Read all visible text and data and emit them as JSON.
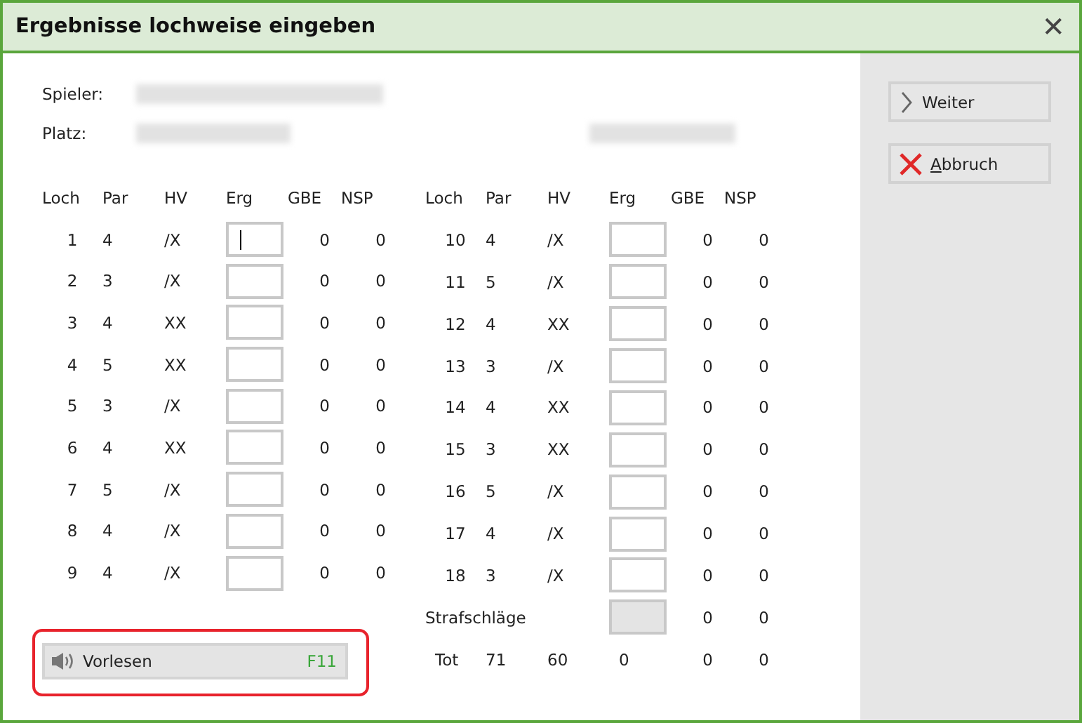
{
  "window": {
    "title": "Ergebnisse lochweise eingeben",
    "close": "✕"
  },
  "info": [
    {
      "label": "Spieler:"
    },
    {
      "label": "Platz:"
    }
  ],
  "columns": [
    "Loch",
    "Par",
    "HV",
    "Erg",
    "GBE",
    "NSP"
  ],
  "columns_back": [
    "Loch",
    "Par",
    "HV",
    "Erg",
    "GBE",
    "NSP"
  ],
  "front": [
    {
      "hole": "1",
      "par": "4",
      "hv": "/X",
      "gbe": "0",
      "nsp": "0",
      "focused": true
    },
    {
      "hole": "2",
      "par": "3",
      "hv": "/X",
      "gbe": "0",
      "nsp": "0",
      "focused": false
    },
    {
      "hole": "3",
      "par": "4",
      "hv": "XX",
      "gbe": "0",
      "nsp": "0",
      "focused": false
    },
    {
      "hole": "4",
      "par": "5",
      "hv": "XX",
      "gbe": "0",
      "nsp": "0",
      "focused": false
    },
    {
      "hole": "5",
      "par": "3",
      "hv": "/X",
      "gbe": "0",
      "nsp": "0",
      "focused": false
    },
    {
      "hole": "6",
      "par": "4",
      "hv": "XX",
      "gbe": "0",
      "nsp": "0",
      "focused": false
    },
    {
      "hole": "7",
      "par": "5",
      "hv": "/X",
      "gbe": "0",
      "nsp": "0",
      "focused": false
    },
    {
      "hole": "8",
      "par": "4",
      "hv": "/X",
      "gbe": "0",
      "nsp": "0",
      "focused": false
    },
    {
      "hole": "9",
      "par": "4",
      "hv": "/X",
      "gbe": "0",
      "nsp": "0",
      "focused": false
    }
  ],
  "back": [
    {
      "hole": "10",
      "par": "4",
      "hv": "/X",
      "gbe": "0",
      "nsp": "0",
      "focused": false
    },
    {
      "hole": "11",
      "par": "5",
      "hv": "/X",
      "gbe": "0",
      "nsp": "0",
      "focused": false
    },
    {
      "hole": "12",
      "par": "4",
      "hv": "XX",
      "gbe": "0",
      "nsp": "0",
      "focused": false
    },
    {
      "hole": "13",
      "par": "3",
      "hv": "/X",
      "gbe": "0",
      "nsp": "0",
      "focused": false
    },
    {
      "hole": "14",
      "par": "4",
      "hv": "XX",
      "gbe": "0",
      "nsp": "0",
      "focused": false
    },
    {
      "hole": "15",
      "par": "3",
      "hv": "XX",
      "gbe": "0",
      "nsp": "0",
      "focused": false
    },
    {
      "hole": "16",
      "par": "5",
      "hv": "/X",
      "gbe": "0",
      "nsp": "0",
      "focused": false
    },
    {
      "hole": "17",
      "par": "4",
      "hv": "/X",
      "gbe": "0",
      "nsp": "0",
      "focused": false
    },
    {
      "hole": "18",
      "par": "3",
      "hv": "/X",
      "gbe": "0",
      "nsp": "0",
      "focused": false
    }
  ],
  "penalty": {
    "label": "Strafschläge",
    "gbe": "0",
    "nsp": "0",
    "disabled": true
  },
  "total": {
    "label": "Tot",
    "par": "71",
    "hv": "60",
    "erg": "0",
    "gbe": "0",
    "nsp": "0"
  },
  "read_aloud": {
    "label": "Vorlesen",
    "shortcut": "F11",
    "highlighted": true
  },
  "buttons": [
    {
      "kind": "next",
      "label": "Weiter",
      "underlined_first": false
    },
    {
      "kind": "cancel",
      "label": "Abbruch",
      "underlined_first": true
    }
  ]
}
